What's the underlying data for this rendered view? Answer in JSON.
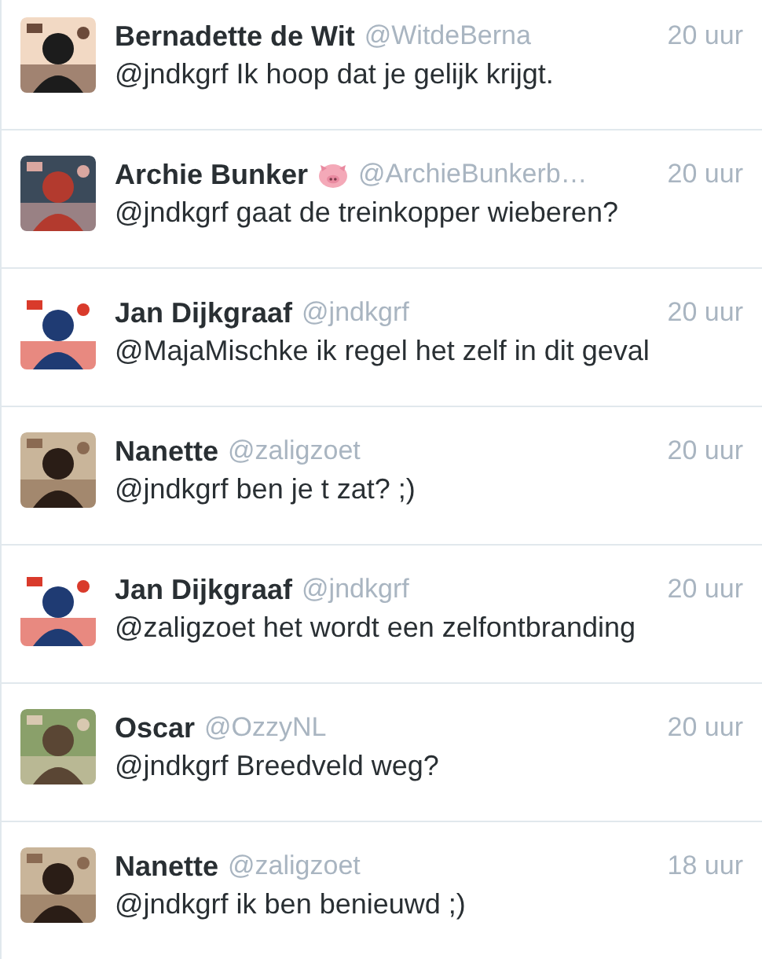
{
  "tweets": [
    {
      "name": "Bernadette de Wit",
      "pig_badge": false,
      "handle": "@WitdeBerna",
      "time": "20 uur",
      "text": "@jndkgrf Ik hoop dat je gelijk krijgt."
    },
    {
      "name": "Archie Bunker",
      "pig_badge": true,
      "handle": "@ArchieBunkerb…",
      "time": "20 uur",
      "text": "@jndkgrf gaat de treinkopper wieberen?"
    },
    {
      "name": "Jan Dijkgraaf",
      "pig_badge": false,
      "handle": "@jndkgrf",
      "time": "20 uur",
      "text": "@MajaMischke ik regel het zelf in dit geval"
    },
    {
      "name": "Nanette",
      "pig_badge": false,
      "handle": "@zaligzoet",
      "time": "20 uur",
      "text": "@jndkgrf ben je t zat? ;)"
    },
    {
      "name": "Jan Dijkgraaf",
      "pig_badge": false,
      "handle": "@jndkgrf",
      "time": "20 uur",
      "text": "@zaligzoet het wordt een zelfontbranding"
    },
    {
      "name": "Oscar",
      "pig_badge": false,
      "handle": "@OzzyNL",
      "time": "20 uur",
      "text": "@jndkgrf Breedveld weg?"
    },
    {
      "name": "Nanette",
      "pig_badge": false,
      "handle": "@zaligzoet",
      "time": "18 uur",
      "text": "@jndkgrf ik ben benieuwd ;)"
    }
  ]
}
